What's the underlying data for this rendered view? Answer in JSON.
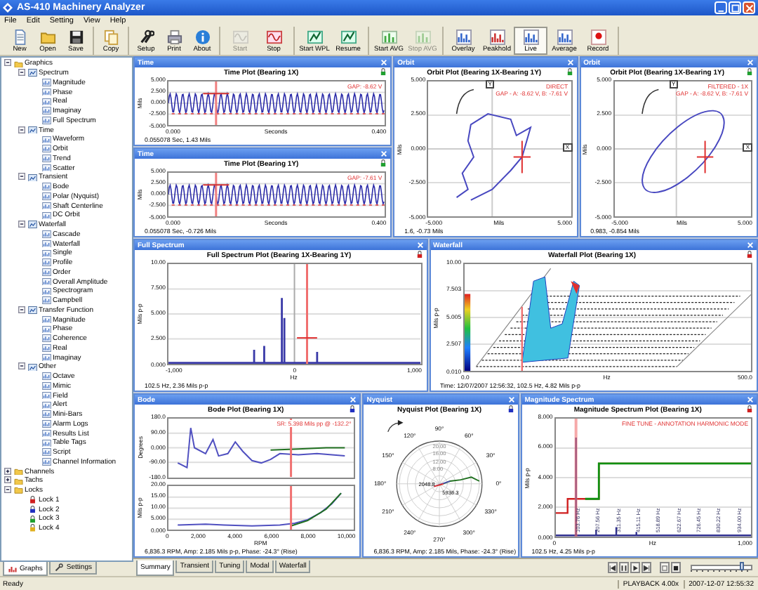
{
  "window": {
    "title": "AS-410 Machinery Analyzer"
  },
  "menu": [
    "File",
    "Edit",
    "Setting",
    "View",
    "Help"
  ],
  "toolbar": [
    [
      {
        "label": "New",
        "kind": "document",
        "disabled": false,
        "pressed": false
      },
      {
        "label": "Open",
        "kind": "folder",
        "disabled": false,
        "pressed": false
      },
      {
        "label": "Save",
        "kind": "disk",
        "disabled": false,
        "pressed": false
      }
    ],
    [
      {
        "label": "Copy",
        "kind": "copy",
        "disabled": false,
        "pressed": false
      }
    ],
    [
      {
        "label": "Setup",
        "kind": "tools",
        "disabled": false,
        "pressed": false
      },
      {
        "label": "Print",
        "kind": "printer",
        "disabled": false,
        "pressed": false
      },
      {
        "label": "About",
        "kind": "info",
        "disabled": false,
        "pressed": false
      }
    ],
    [
      {
        "label": "Start",
        "kind": "wave",
        "disabled": true,
        "pressed": false
      },
      {
        "label": "Stop",
        "kind": "wave-stop",
        "disabled": false,
        "pressed": false
      }
    ],
    [
      {
        "label": "Start WPL",
        "kind": "pen",
        "disabled": false,
        "pressed": false
      },
      {
        "label": "Resume",
        "kind": "pen",
        "disabled": false,
        "pressed": false
      }
    ],
    [
      {
        "label": "Start AVG",
        "kind": "bars",
        "disabled": false,
        "pressed": false
      },
      {
        "label": "Stop AVG",
        "kind": "bars",
        "disabled": true,
        "pressed": false
      }
    ],
    [
      {
        "label": "Overlay",
        "kind": "chart",
        "disabled": false,
        "pressed": false
      },
      {
        "label": "Peakhold",
        "kind": "peak",
        "disabled": false,
        "pressed": false
      },
      {
        "label": "Live",
        "kind": "chart",
        "disabled": false,
        "pressed": true
      },
      {
        "label": "Average",
        "kind": "chart",
        "disabled": false,
        "pressed": false
      },
      {
        "label": "Record",
        "kind": "record",
        "disabled": false,
        "pressed": false
      }
    ]
  ],
  "tree": [
    {
      "label": "Graphics",
      "kind": "folder",
      "expanded": true,
      "children": [
        {
          "label": "Spectrum",
          "kind": "group",
          "expanded": true,
          "children": [
            {
              "label": "Magnitude",
              "kind": "chart"
            },
            {
              "label": "Phase",
              "kind": "chart"
            },
            {
              "label": "Real",
              "kind": "chart"
            },
            {
              "label": "Imaginay",
              "kind": "chart"
            },
            {
              "label": "Full Spectrum",
              "kind": "chart"
            }
          ]
        },
        {
          "label": "Time",
          "kind": "group",
          "expanded": true,
          "children": [
            {
              "label": "Waveform",
              "kind": "chart"
            },
            {
              "label": "Orbit",
              "kind": "chart"
            },
            {
              "label": "Trend",
              "kind": "chart"
            },
            {
              "label": "Scatter",
              "kind": "chart"
            }
          ]
        },
        {
          "label": "Transient",
          "kind": "group",
          "expanded": true,
          "children": [
            {
              "label": "Bode",
              "kind": "chart"
            },
            {
              "label": "Polar (Nyquist)",
              "kind": "chart"
            },
            {
              "label": "Shaft Centerline",
              "kind": "chart"
            },
            {
              "label": "DC Orbit",
              "kind": "chart"
            }
          ]
        },
        {
          "label": "Waterfall",
          "kind": "group",
          "expanded": true,
          "children": [
            {
              "label": "Cascade",
              "kind": "chart"
            },
            {
              "label": "Waterfall",
              "kind": "chart"
            },
            {
              "label": "Single",
              "kind": "chart"
            },
            {
              "label": "Profile",
              "kind": "chart"
            },
            {
              "label": "Order",
              "kind": "chart"
            },
            {
              "label": "Overall Amplitude",
              "kind": "chart"
            },
            {
              "label": "Spectrogram",
              "kind": "chart"
            },
            {
              "label": "Campbell",
              "kind": "chart"
            }
          ]
        },
        {
          "label": "Transfer Function",
          "kind": "group",
          "expanded": true,
          "children": [
            {
              "label": "Magnitude",
              "kind": "chart"
            },
            {
              "label": "Phase",
              "kind": "chart"
            },
            {
              "label": "Coherence",
              "kind": "chart"
            },
            {
              "label": "Real",
              "kind": "chart"
            },
            {
              "label": "Imaginay",
              "kind": "chart"
            }
          ]
        },
        {
          "label": "Other",
          "kind": "group",
          "expanded": true,
          "children": [
            {
              "label": "Octave",
              "kind": "chart"
            },
            {
              "label": "Mimic",
              "kind": "chart"
            },
            {
              "label": "Field",
              "kind": "chart"
            },
            {
              "label": "Alert",
              "kind": "chart"
            },
            {
              "label": "Mini-Bars",
              "kind": "chart"
            },
            {
              "label": "Alarm Logs",
              "kind": "chart"
            },
            {
              "label": "Results List",
              "kind": "chart"
            },
            {
              "label": "Table Tags",
              "kind": "chart"
            },
            {
              "label": "Script",
              "kind": "chart"
            },
            {
              "label": "Channel Information",
              "kind": "chart"
            }
          ]
        }
      ]
    },
    {
      "label": "Channels",
      "kind": "folder",
      "expanded": false
    },
    {
      "label": "Tachs",
      "kind": "folder",
      "expanded": false
    },
    {
      "label": "Locks",
      "kind": "folder",
      "expanded": true,
      "children": [
        {
          "label": "Lock 1",
          "kind": "lock",
          "color": "#d02020"
        },
        {
          "label": "Lock 2",
          "kind": "lock",
          "color": "#2030c0"
        },
        {
          "label": "Lock 3",
          "kind": "lock",
          "color": "#20a030"
        },
        {
          "label": "Lock 4",
          "kind": "lock",
          "color": "#e0b020"
        }
      ]
    }
  ],
  "side_tabs": [
    {
      "label": "Graphs",
      "selected": true
    },
    {
      "label": "Settings",
      "selected": false
    }
  ],
  "panel_rows": [
    {
      "columns": [
        {
          "panels": [
            {
              "title": "Time",
              "kind": "cartesian",
              "plot_title": "Time Plot (Bearing 1X)",
              "color": "#20a030",
              "plots": [
                {
                  "kind": "time",
                  "y_label": "Mils",
                  "y_ticks": [
                    "5.000",
                    "2.500",
                    "0.000",
                    "-2.500",
                    "-5.000"
                  ],
                  "x_ticks": [
                    "0.000",
                    "0.400"
                  ],
                  "x_label": "Seconds",
                  "annotations": [
                    "GAP: -8.62 V"
                  ]
                }
              ],
              "readout": "0.055078 Sec, 1.43 Mils"
            },
            {
              "title": "Time",
              "kind": "cartesian",
              "plot_title": "Time Plot (Bearing 1Y)",
              "color": "#20a030",
              "plots": [
                {
                  "kind": "time",
                  "y_label": "Mils",
                  "y_ticks": [
                    "5.000",
                    "2.500",
                    "0.000",
                    "-2.500",
                    "-5.000"
                  ],
                  "x_ticks": [
                    "0.000",
                    "0.400"
                  ],
                  "x_label": "Seconds",
                  "annotations": [
                    "GAP: -7.61 V"
                  ]
                }
              ],
              "readout": "0.055078 Sec, -0.726 Mils"
            }
          ]
        },
        {
          "panels": [
            {
              "title": "Orbit",
              "kind": "cartesian",
              "plot_title": "Orbit Plot (Bearing 1X-Bearing 1Y)",
              "color": "#20a030",
              "plots": [
                {
                  "kind": "orbit-direct",
                  "y_label": "Mils",
                  "y_ticks": [
                    "5.000",
                    "2.500",
                    "0.000",
                    "-2.500",
                    "-5.000"
                  ],
                  "x_ticks": [
                    "-5.000",
                    "5.000"
                  ],
                  "x_label": "Mils",
                  "annotations": [
                    "DIRECT",
                    "GAP - A: -8.62 V, B: -7.61 V"
                  ],
                  "markers": [
                    "Y",
                    "X"
                  ]
                }
              ],
              "readout": "1.6, -0.73 Mils"
            }
          ]
        },
        {
          "panels": [
            {
              "title": "Orbit",
              "kind": "cartesian",
              "plot_title": "Orbit Plot (Bearing 1X-Bearing 1Y)",
              "color": "#20a030",
              "plots": [
                {
                  "kind": "orbit-filtered",
                  "y_label": "Mils",
                  "y_ticks": [
                    "5.000",
                    "2.500",
                    "0.000",
                    "-2.500",
                    "-5.000"
                  ],
                  "x_ticks": [
                    "-5.000",
                    "5.000"
                  ],
                  "x_label": "Mils",
                  "annotations": [
                    "FILTERED - 1X",
                    "GAP - A: -8.62 V, B: -7.61 V"
                  ],
                  "markers": [
                    "Y",
                    "X"
                  ]
                }
              ],
              "readout": "0.983, -0.854 Mils"
            }
          ]
        }
      ]
    },
    {
      "columns": [
        {
          "panels": [
            {
              "title": "Full Spectrum",
              "kind": "cartesian",
              "plot_title": "Full Spectrum Plot (Bearing 1X-Bearing 1Y)",
              "color": "#d02020",
              "plots": [
                {
                  "kind": "full-spectrum",
                  "y_label": "Mils p-p",
                  "y_ticks": [
                    "10.00",
                    "7.500",
                    "5.000",
                    "2.500",
                    "0.000"
                  ],
                  "x_ticks": [
                    "-1,000",
                    "0",
                    "1,000"
                  ],
                  "x_label": "Hz"
                }
              ],
              "readout": "102.5 Hz, 2.36 Mils p-p"
            }
          ]
        },
        {
          "panels": [
            {
              "title": "Waterfall",
              "kind": "cartesian",
              "plot_title": "Waterfall Plot (Bearing 1X)",
              "color": "#d02020",
              "plots": [
                {
                  "kind": "waterfall",
                  "y_label": "Mils p-p",
                  "y_ticks": [
                    "10.00",
                    "7.503",
                    "5.005",
                    "2.507",
                    "0.010"
                  ],
                  "x_ticks": [
                    "0.0",
                    "500.0"
                  ],
                  "x_label": "Hz"
                }
              ],
              "readout": "Time: 12/07/2007 12:56:32, 102.5 Hz, 4.82 Mils p-p"
            }
          ]
        }
      ]
    },
    {
      "columns": [
        {
          "panels": [
            {
              "title": "Bode",
              "kind": "cartesian",
              "plot_title": "Bode Plot (Bearing 1X)",
              "color": "#2030c0",
              "plots": [
                {
                  "kind": "bode-phase",
                  "y_label": "Degrees",
                  "y_ticks": [
                    "180.0",
                    "90.00",
                    "0.000",
                    "-90.00",
                    "-180.0"
                  ],
                  "annotations": [
                    "SR: 5.398 Mils pp @ -132.2°"
                  ]
                },
                {
                  "kind": "bode-amp",
                  "y_label": "Mils p-p",
                  "y_ticks": [
                    "20.00",
                    "15.00",
                    "10.00",
                    "5.000",
                    "0.000"
                  ],
                  "x_ticks": [
                    "0",
                    "2,000",
                    "4,000",
                    "6,000",
                    "8,000",
                    "10,000"
                  ],
                  "x_label": "RPM"
                }
              ],
              "readout": "6,836.3 RPM, Amp: 2.185 Mils p-p, Phase: -24.3° (Rise)"
            }
          ]
        },
        {
          "panels": [
            {
              "title": "Nyquist",
              "kind": "polar",
              "plot_title": "Nyquist Plot (Bearing 1X)",
              "color": "#2030c0",
              "angles": [
                "90°",
                "60°",
                "30°",
                "0°",
                "330°",
                "300°",
                "270°",
                "240°",
                "210°",
                "180°",
                "150°",
                "120°"
              ],
              "rings": [
                "20.00",
                "16.00",
                "12.00",
                "8.00"
              ],
              "point_labels": [
                "2048.8",
                "5936.3"
              ],
              "readout": "6,836.3 RPM, Amp: 2.185 Mils, Phase: -24.3° (Rise)"
            }
          ]
        },
        {
          "panels": [
            {
              "title": "Magnitude Spectrum",
              "kind": "cartesian",
              "plot_title": "Magnitude Spectrum Plot (Bearing 1X)",
              "color": "#d02020",
              "plots": [
                {
                  "kind": "magnitude",
                  "y_label": "Mils p-p",
                  "y_ticks": [
                    "8.000",
                    "6.000",
                    "4.000",
                    "2.000",
                    "0.000"
                  ],
                  "x_ticks": [
                    "0",
                    "1,000"
                  ],
                  "x_label": "Hz",
                  "annotations": [
                    "FINE TUNE - ANNOTATION HARMONIC MODE"
                  ],
                  "peaks": [
                    "103.76 Hz",
                    "207.56 Hz",
                    "311.35 Hz",
                    "415.11 Hz",
                    "518.89 Hz",
                    "622.67 Hz",
                    "726.45 Hz",
                    "830.22 Hz",
                    "934.00 Hz"
                  ]
                }
              ],
              "readout": "102.5 Hz, 4.25 Mils p-p"
            }
          ]
        }
      ]
    }
  ],
  "bottom_tabs": [
    {
      "label": "Summary",
      "selected": true
    },
    {
      "label": "Transient",
      "selected": false
    },
    {
      "label": "Tuning",
      "selected": false
    },
    {
      "label": "Modal",
      "selected": false
    },
    {
      "label": "Waterfall",
      "selected": false
    }
  ],
  "playback": {
    "level": 0.82
  },
  "status_bar": {
    "message": "Ready",
    "mode": "PLAYBACK 4.00x",
    "time": "2007-12-07 12:55:32"
  }
}
